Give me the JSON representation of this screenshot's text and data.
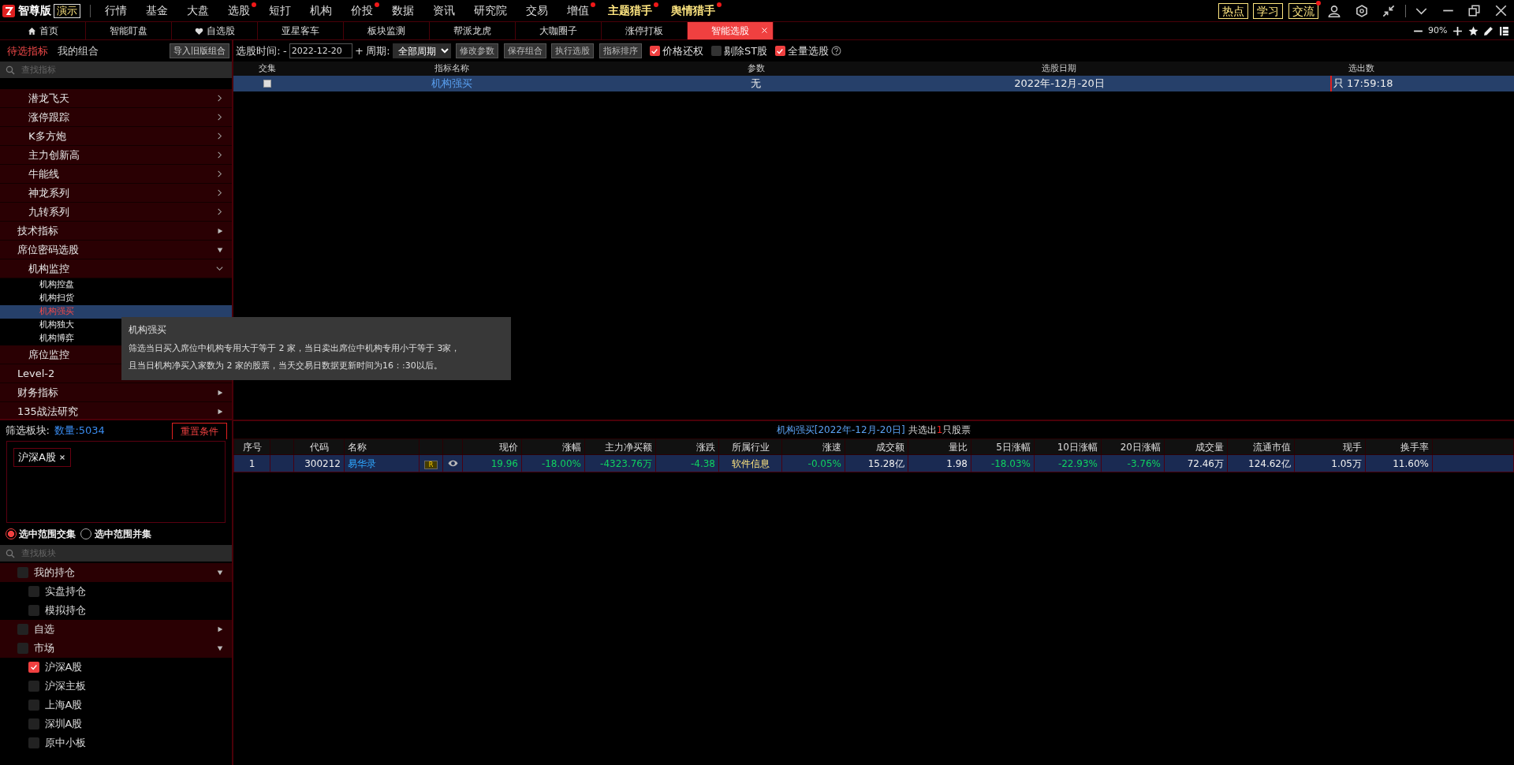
{
  "app": {
    "logo": "智尊版",
    "mode_badge": "演示"
  },
  "menu": [
    {
      "label": "行情",
      "dot": false,
      "highlight": false
    },
    {
      "label": "基金",
      "dot": false,
      "highlight": false
    },
    {
      "label": "大盘",
      "dot": false,
      "highlight": false
    },
    {
      "label": "选股",
      "dot": true,
      "highlight": false
    },
    {
      "label": "短打",
      "dot": false,
      "highlight": false
    },
    {
      "label": "机构",
      "dot": false,
      "highlight": false
    },
    {
      "label": "价投",
      "dot": true,
      "highlight": false
    },
    {
      "label": "数据",
      "dot": false,
      "highlight": false
    },
    {
      "label": "资讯",
      "dot": false,
      "highlight": false
    },
    {
      "label": "研究院",
      "dot": false,
      "highlight": false
    },
    {
      "label": "交易",
      "dot": false,
      "highlight": false
    },
    {
      "label": "增值",
      "dot": true,
      "highlight": false
    },
    {
      "label": "主题猎手",
      "dot": true,
      "highlight": true
    },
    {
      "label": "舆情猎手",
      "dot": true,
      "highlight": true
    }
  ],
  "quick_buttons": [
    {
      "label": "热点",
      "dot": false
    },
    {
      "label": "学习",
      "dot": false
    },
    {
      "label": "交流",
      "dot": true
    }
  ],
  "tabs": [
    {
      "label": "首页",
      "kind": "home",
      "selected": false
    },
    {
      "label": "智能盯盘",
      "selected": false
    },
    {
      "label": "自选股",
      "kind": "favorite",
      "selected": false
    },
    {
      "label": "亚星客车",
      "selected": false
    },
    {
      "label": "板块监测",
      "selected": false
    },
    {
      "label": "帮派龙虎",
      "selected": false
    },
    {
      "label": "大咖圈子",
      "selected": false
    },
    {
      "label": "涨停打板",
      "selected": false
    },
    {
      "label": "智能选股",
      "selected": true,
      "closable": true
    }
  ],
  "zoom": {
    "reading": "90%"
  },
  "left_tabs": [
    {
      "label": "待选指标",
      "selected": true
    },
    {
      "label": "我的组合",
      "selected": false
    }
  ],
  "import_button": "导入旧版组合",
  "indicator_search": {
    "placeholder": "查找指标"
  },
  "indicator_tree": [
    {
      "children": [
        {
          "label": "潜龙飞天",
          "expanded": false
        },
        {
          "label": "涨停跟踪",
          "expanded": false
        },
        {
          "label": "K多方炮",
          "expanded": false
        },
        {
          "label": "主力创新高",
          "expanded": false
        },
        {
          "label": "牛能线",
          "expanded": false
        },
        {
          "label": "神龙系列",
          "expanded": false
        },
        {
          "label": "九转系列",
          "expanded": false
        }
      ]
    },
    {
      "label": "技术指标",
      "expanded": false
    },
    {
      "label": "席位密码选股",
      "expanded": true,
      "children": [
        {
          "label": "机构监控",
          "expanded": true,
          "children": [
            {
              "label": "机构控盘",
              "selected": false
            },
            {
              "label": "机构扫货",
              "selected": false
            },
            {
              "label": "机构强买",
              "selected": true
            },
            {
              "label": "机构独大",
              "selected": false
            },
            {
              "label": "机构博弈",
              "selected": false
            }
          ]
        },
        {
          "label": "席位监控"
        }
      ]
    },
    {
      "label": "Level-2"
    },
    {
      "label": "财务指标",
      "expanded": false
    },
    {
      "label": "135战法研究",
      "expanded": false
    }
  ],
  "toolbar": {
    "time_label": "选股时间:",
    "minus": "-",
    "date": "2022-12-20",
    "plus": "+",
    "period_label": "周期:",
    "period": "全部周期",
    "buttons": [
      "修改参数",
      "保存组合",
      "执行选股",
      "指标排序"
    ],
    "checks": [
      {
        "label": "价格还权",
        "checked": true
      },
      {
        "label": "剔除ST股",
        "checked": false
      },
      {
        "label": "全量选股",
        "checked": true
      }
    ]
  },
  "strategy_table": {
    "columns": [
      "交集",
      "指标名称",
      "参数",
      "选股日期",
      "选出数"
    ],
    "rows": [
      {
        "selected": true,
        "checked": false,
        "name": "机构强买",
        "params": "无",
        "date": "2022年-12月-20日",
        "count": "只 17:59:18"
      }
    ]
  },
  "tooltip": {
    "title": "机构强买",
    "lines": [
      "筛选当日买入席位中机构专用大于等于 2 家，当日卖出席位中机构专用小于等于 3家，",
      "且当日机构净买入家数为 2 家的股票，当天交易日数据更新时间为16：:30以后。"
    ]
  },
  "filter": {
    "label": "筛选板块:",
    "count": "数量:5034",
    "reset_button": "重置条件",
    "tags": [
      "沪深A股"
    ],
    "modes": [
      {
        "label": "选中范围交集",
        "selected": true
      },
      {
        "label": "选中范围并集",
        "selected": false
      }
    ],
    "search": {
      "placeholder": "查找板块"
    },
    "tree": [
      {
        "label": "我的持仓",
        "checked": false,
        "expanded": true,
        "children": [
          {
            "label": "实盘持仓",
            "checked": false
          },
          {
            "label": "模拟持仓",
            "checked": false
          }
        ]
      },
      {
        "label": "自选",
        "checked": false,
        "expanded": false
      },
      {
        "label": "市场",
        "checked": false,
        "expanded": true,
        "children": [
          {
            "label": "沪深A股",
            "checked": true
          },
          {
            "label": "沪深主板",
            "checked": false
          },
          {
            "label": "上海A股",
            "checked": false
          },
          {
            "label": "深圳A股",
            "checked": false
          },
          {
            "label": "原中小板",
            "checked": false
          }
        ]
      }
    ]
  },
  "result": {
    "title": "机构强买[2022年-12月-20日]",
    "middle": "共选出",
    "count": "1",
    "suffix": "只股票",
    "columns": {
      "index": "序号",
      "code": "代码",
      "name": "名称",
      "values": [
        "现价",
        "涨幅",
        "主力净买额",
        "涨跌",
        "所属行业",
        "涨速",
        "成交额",
        "量比",
        "5日涨幅",
        "10日涨幅",
        "20日涨幅",
        "成交量",
        "流通市值",
        "现手",
        "换手率"
      ]
    },
    "rows": [
      {
        "selected": true,
        "index": "1",
        "code": "300212",
        "name": "易华录",
        "badge": "R",
        "watch": true,
        "values": [
          {
            "text": "19.96",
            "kind": "down"
          },
          {
            "text": "-18.00%",
            "kind": "down"
          },
          {
            "text": "-4323.76万",
            "kind": "down"
          },
          {
            "text": "-4.38",
            "kind": "down"
          },
          {
            "text": "软件信息",
            "kind": "industry"
          },
          {
            "text": "-0.05%",
            "kind": "down"
          },
          {
            "text": "15.28亿",
            "kind": "plain"
          },
          {
            "text": "1.98",
            "kind": "plain"
          },
          {
            "text": "-18.03%",
            "kind": "down"
          },
          {
            "text": "-22.93%",
            "kind": "down"
          },
          {
            "text": "-3.76%",
            "kind": "down"
          },
          {
            "text": "72.46万",
            "kind": "plain"
          },
          {
            "text": "124.62亿",
            "kind": "plain"
          },
          {
            "text": "1.05万",
            "kind": "plain"
          },
          {
            "text": "11.60%",
            "kind": "plain"
          }
        ]
      }
    ]
  }
}
